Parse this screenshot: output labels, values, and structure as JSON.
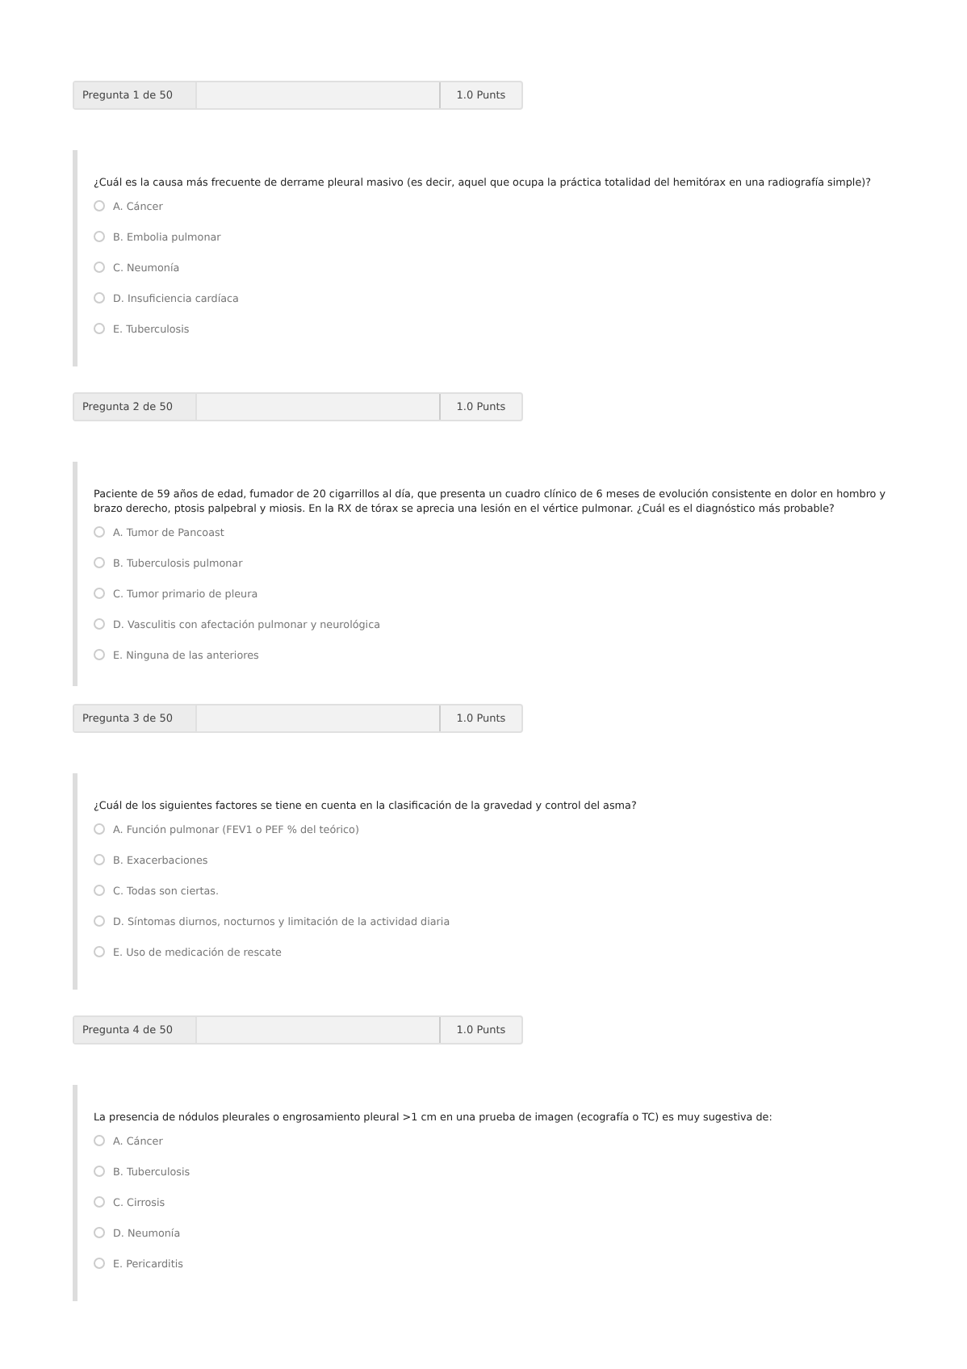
{
  "questions": [
    {
      "header": "Pregunta 1 de 50",
      "points": "1.0 Punts",
      "text": "¿Cuál es la causa más frecuente de derrame pleural masivo (es decir, aquel que ocupa la práctica totalidad del hemitórax en una radiografía simple)?",
      "options": [
        {
          "label": "A. Cáncer",
          "selected": false
        },
        {
          "label": "B. Embolia pulmonar",
          "selected": false
        },
        {
          "label": "C. Neumonía",
          "selected": false
        },
        {
          "label": "D. Insuficiencia cardíaca",
          "selected": false
        },
        {
          "label": "E. Tuberculosis",
          "selected": false
        }
      ]
    },
    {
      "header": "Pregunta 2 de 50",
      "points": "1.0 Punts",
      "text": "Paciente de 59 años de edad, fumador de 20 cigarrillos al día, que presenta un cuadro clínico de 6 meses de evolución consistente en dolor en hombro y brazo derecho, ptosis palpebral y miosis. En la RX de tórax se aprecia una lesión en el vértice pulmonar. ¿Cuál es el diagnóstico más probable?",
      "options": [
        {
          "label": "A. Tumor de Pancoast",
          "selected": false
        },
        {
          "label": "B. Tuberculosis pulmonar",
          "selected": false
        },
        {
          "label": "C. Tumor primario de pleura",
          "selected": false
        },
        {
          "label": "D. Vasculitis con afectación pulmonar y neurológica",
          "selected": false
        },
        {
          "label": "E. Ninguna de las anteriores",
          "selected": false
        }
      ]
    },
    {
      "header": "Pregunta 3 de 50",
      "points": "1.0 Punts",
      "text": "¿Cuál de los siguientes factores se tiene en cuenta en la clasificación de la gravedad y control del asma?",
      "options": [
        {
          "label": "A. Función pulmonar (FEV1 o PEF % del teórico)",
          "selected": false
        },
        {
          "label": "B. Exacerbaciones",
          "selected": false
        },
        {
          "label": "C. Todas son ciertas.",
          "selected": false
        },
        {
          "label": "D. Síntomas diurnos, nocturnos y limitación de la actividad diaria",
          "selected": false
        },
        {
          "label": "E. Uso de medicación de rescate",
          "selected": false
        }
      ]
    },
    {
      "header": "Pregunta 4 de 50",
      "points": "1.0 Punts",
      "text": "La presencia de nódulos pleurales o engrosamiento pleural >1 cm en una prueba de imagen (ecografía o TC) es muy sugestiva de:",
      "options": [
        {
          "label": "A. Cáncer",
          "selected": false
        },
        {
          "label": "B. Tuberculosis",
          "selected": false
        },
        {
          "label": "C. Cirrosis",
          "selected": false
        },
        {
          "label": "D. Neumonía",
          "selected": false
        },
        {
          "label": "E. Pericarditis",
          "selected": false
        }
      ]
    }
  ]
}
